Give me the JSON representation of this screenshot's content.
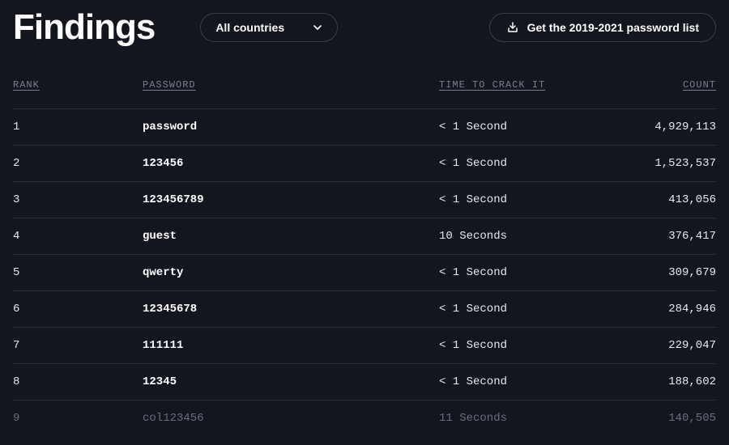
{
  "header": {
    "title": "Findings",
    "dropdown_label": "All countries",
    "download_label": "Get the 2019-2021 password list"
  },
  "columns": {
    "rank": "RANK",
    "password": "PASSWORD",
    "time": "TIME TO CRACK IT",
    "count": "COUNT"
  },
  "rows": [
    {
      "rank": "1",
      "password": "password",
      "time": "< 1 Second",
      "count": "4,929,113",
      "faded": false
    },
    {
      "rank": "2",
      "password": "123456",
      "time": "< 1 Second",
      "count": "1,523,537",
      "faded": false
    },
    {
      "rank": "3",
      "password": "123456789",
      "time": "< 1 Second",
      "count": "413,056",
      "faded": false
    },
    {
      "rank": "4",
      "password": "guest",
      "time": "10 Seconds",
      "count": "376,417",
      "faded": false
    },
    {
      "rank": "5",
      "password": "qwerty",
      "time": "< 1 Second",
      "count": "309,679",
      "faded": false
    },
    {
      "rank": "6",
      "password": "12345678",
      "time": "< 1 Second",
      "count": "284,946",
      "faded": false
    },
    {
      "rank": "7",
      "password": "111111",
      "time": "< 1 Second",
      "count": "229,047",
      "faded": false
    },
    {
      "rank": "8",
      "password": "12345",
      "time": "< 1 Second",
      "count": "188,602",
      "faded": false
    },
    {
      "rank": "9",
      "password": "col123456",
      "time": "11 Seconds",
      "count": "140,505",
      "faded": true
    }
  ]
}
